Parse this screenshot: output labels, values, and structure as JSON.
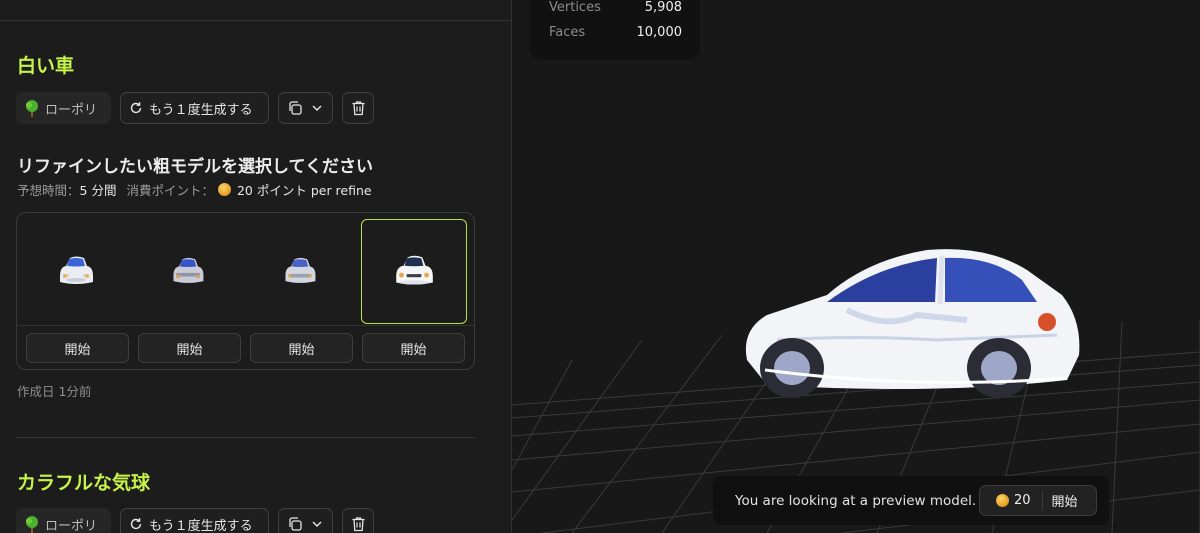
{
  "project1": {
    "title": "白い車",
    "category_label": "ローポリ",
    "regenerate_label": "もう１度生成する"
  },
  "refine": {
    "heading": "リファインしたい粗モデルを選択してください",
    "time_label": "予想時間：",
    "time_value": "5 分間",
    "points_label": "消費ポイント：",
    "points_value": "20 ポイント per refine",
    "options": [
      {
        "start_label": "開始",
        "selected": false
      },
      {
        "start_label": "開始",
        "selected": false
      },
      {
        "start_label": "開始",
        "selected": false
      },
      {
        "start_label": "開始",
        "selected": true
      }
    ],
    "created": "作成日 1分前"
  },
  "project2": {
    "title": "カラフルな気球",
    "category_label": "ローポリ",
    "regenerate_label": "もう１度生成する"
  },
  "stats": {
    "vertices_label": "Vertices",
    "vertices_value": "5,908",
    "faces_label": "Faces",
    "faces_value": "10,000"
  },
  "preview": {
    "message": "You are looking at a preview model.",
    "cost": "20",
    "start_label": "開始"
  },
  "colors": {
    "accent": "#c6f34a",
    "selected_border": "#b7e045"
  }
}
